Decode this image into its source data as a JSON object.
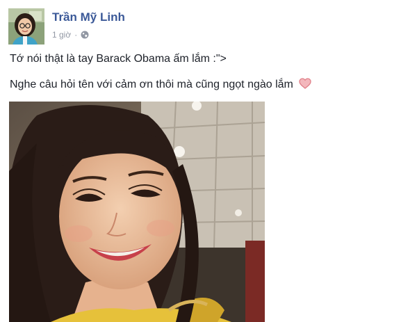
{
  "post": {
    "author": "Trần Mỹ Linh",
    "time": "1 giờ",
    "separator": "·",
    "privacy_icon": "globe-icon",
    "lines": [
      "Tớ nói thật là tay Barack Obama ấm lắm :\">",
      "Nghe câu hỏi tên với cảm ơn thôi mà cũng ngọt ngào lắm"
    ],
    "emoji_icon": "heart-icon"
  },
  "colors": {
    "author_name": "#3b5998",
    "meta_text": "#9197a3",
    "heart": "#e8888f"
  }
}
